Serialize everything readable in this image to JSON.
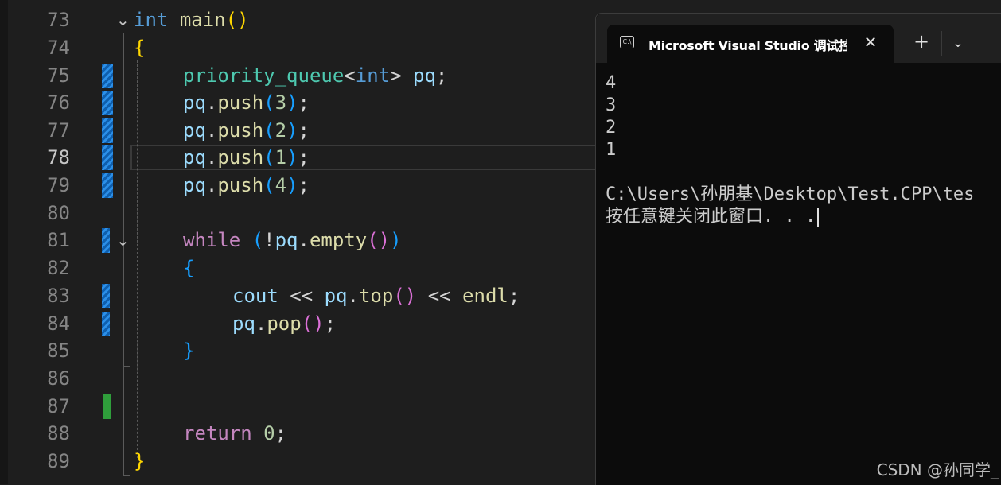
{
  "editor": {
    "lines": [
      {
        "n": "73"
      },
      {
        "n": "74"
      },
      {
        "n": "75"
      },
      {
        "n": "76"
      },
      {
        "n": "77"
      },
      {
        "n": "78"
      },
      {
        "n": "79"
      },
      {
        "n": "80"
      },
      {
        "n": "81"
      },
      {
        "n": "82"
      },
      {
        "n": "83"
      },
      {
        "n": "84"
      },
      {
        "n": "85"
      },
      {
        "n": "86"
      },
      {
        "n": "87"
      },
      {
        "n": "88"
      },
      {
        "n": "89"
      }
    ],
    "tokens": {
      "t73": [
        "int",
        "main",
        "(",
        ")"
      ],
      "t74": [
        "{"
      ],
      "t75": [
        "priority_queue",
        "<",
        "int",
        ">",
        "pq",
        ";"
      ],
      "t76": [
        "pq",
        ".",
        "push",
        "(",
        "3",
        ")",
        ";"
      ],
      "t77": [
        "pq",
        ".",
        "push",
        "(",
        "2",
        ")",
        ";"
      ],
      "t78": [
        "pq",
        ".",
        "push",
        "(",
        "1",
        ")",
        ";"
      ],
      "t79": [
        "pq",
        ".",
        "push",
        "(",
        "4",
        ")",
        ";"
      ],
      "t81": [
        "while",
        "(",
        "!",
        "pq",
        ".",
        "empty",
        "(",
        ")",
        ")"
      ],
      "t82": [
        "{"
      ],
      "t83": [
        "cout",
        "<<",
        "pq",
        ".",
        "top",
        "(",
        ")",
        "<<",
        "endl",
        ";"
      ],
      "t84": [
        "pq",
        ".",
        "pop",
        "(",
        ")",
        ";"
      ],
      "t85": [
        "}"
      ],
      "t88": [
        "return",
        "0",
        ";"
      ],
      "t89": [
        "}"
      ]
    },
    "fold_icon": "chevron-down-icon",
    "active_line": "78"
  },
  "terminal": {
    "tab_title": "Microsoft Visual Studio 调试控",
    "tab_icon": "console-icon",
    "close_glyph": "✕",
    "new_tab_glyph": "+",
    "dropdown_glyph": "⌄",
    "output": [
      "4",
      "3",
      "2",
      "1",
      "",
      "C:\\Users\\孙朋基\\Desktop\\Test.CPP\\tes",
      "按任意键关闭此窗口. . ."
    ]
  },
  "watermark": "CSDN @孙同学_",
  "colors": {
    "background": "#1e1e1e",
    "terminal_bg": "#0c0c0c",
    "keyword": "#569cd6",
    "control_keyword": "#c586c0",
    "function": "#dcdcaa",
    "type": "#4ec9b0",
    "variable": "#9cdcfe",
    "number": "#b5cea8",
    "change_marker_blue": "#2b8fe8",
    "change_marker_green": "#2f9e3b"
  }
}
